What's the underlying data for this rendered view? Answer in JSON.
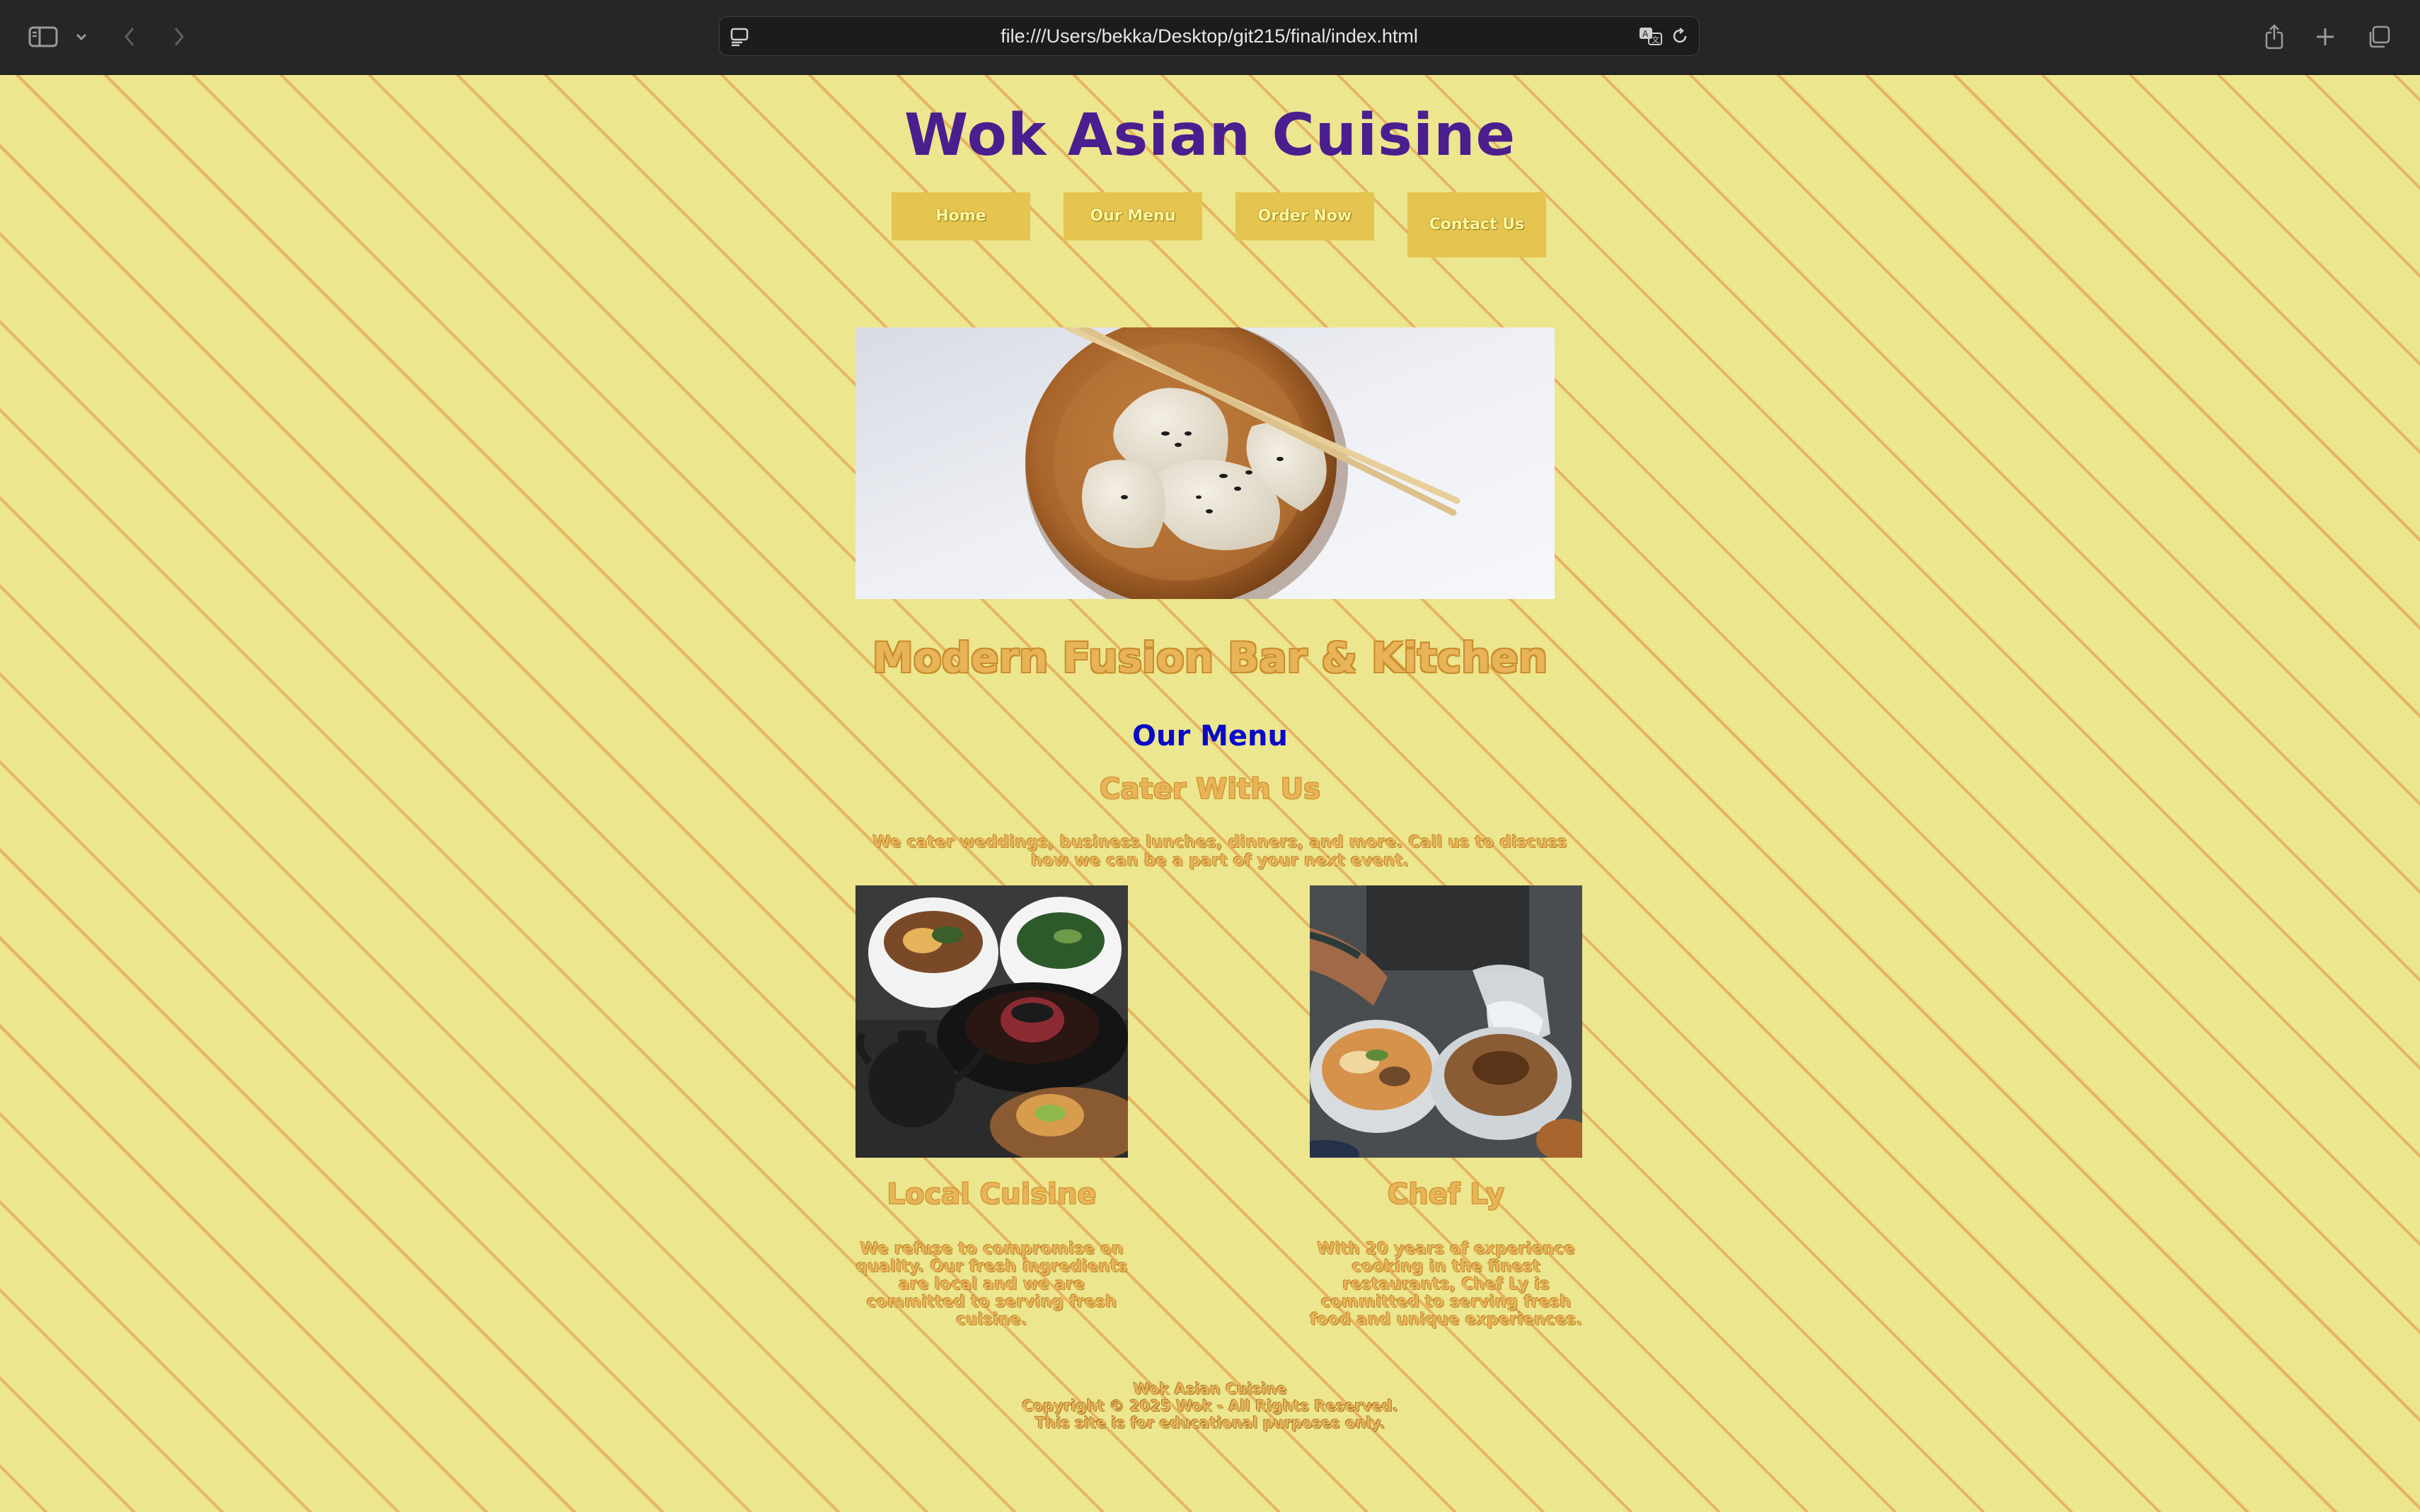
{
  "browser": {
    "url": "file:///Users/bekka/Desktop/git215/final/index.html",
    "icons": [
      "sidebar-icon",
      "chevron-down-icon",
      "back-icon",
      "forward-icon",
      "reader-icon",
      "translate-icon",
      "reload-icon",
      "share-icon",
      "new-tab-icon",
      "tabs-overview-icon"
    ]
  },
  "site": {
    "title": "Wok Asian Cuisine",
    "nav": [
      "Home",
      "Our Menu",
      "Order Now",
      "Contact Us"
    ],
    "hero_alt": "Dumplings with chopsticks on a wooden plate",
    "subtitle": "Modern Fusion Bar & Kitchen",
    "menu_link": "Our Menu",
    "cater_heading": "Cater With Us",
    "cater_text": "We cater weddings, business lunches, dinners, and more. Call us to discuss how we can be a part of your next event.",
    "cards": [
      {
        "heading": "Local Cuisine",
        "text": "We refuse to compromise on quality. Our fresh ingredients are local and we are committed to serving fresh cuisine.",
        "alt": "Bowls of Asian dishes with a teapot"
      },
      {
        "heading": "Chef Ly",
        "text": "With 20 years of experience cooking in the finest restaurants, Chef Ly is committed to serving fresh food and unique experiences.",
        "alt": "Chef preparing ramen bowls"
      }
    ],
    "footer": [
      "Wok Asian Cuisine",
      "Copyright © 2025 Wok - All Rights Reserved.",
      "This site is for educational purposes only."
    ]
  },
  "colors": {
    "page_bg": "#ECE68E",
    "stripe": "#E18C3C",
    "title": "#4B1E8F",
    "nav_bg": "#E5C44F",
    "accent": "#E8B457",
    "link": "#0A0AC8"
  }
}
